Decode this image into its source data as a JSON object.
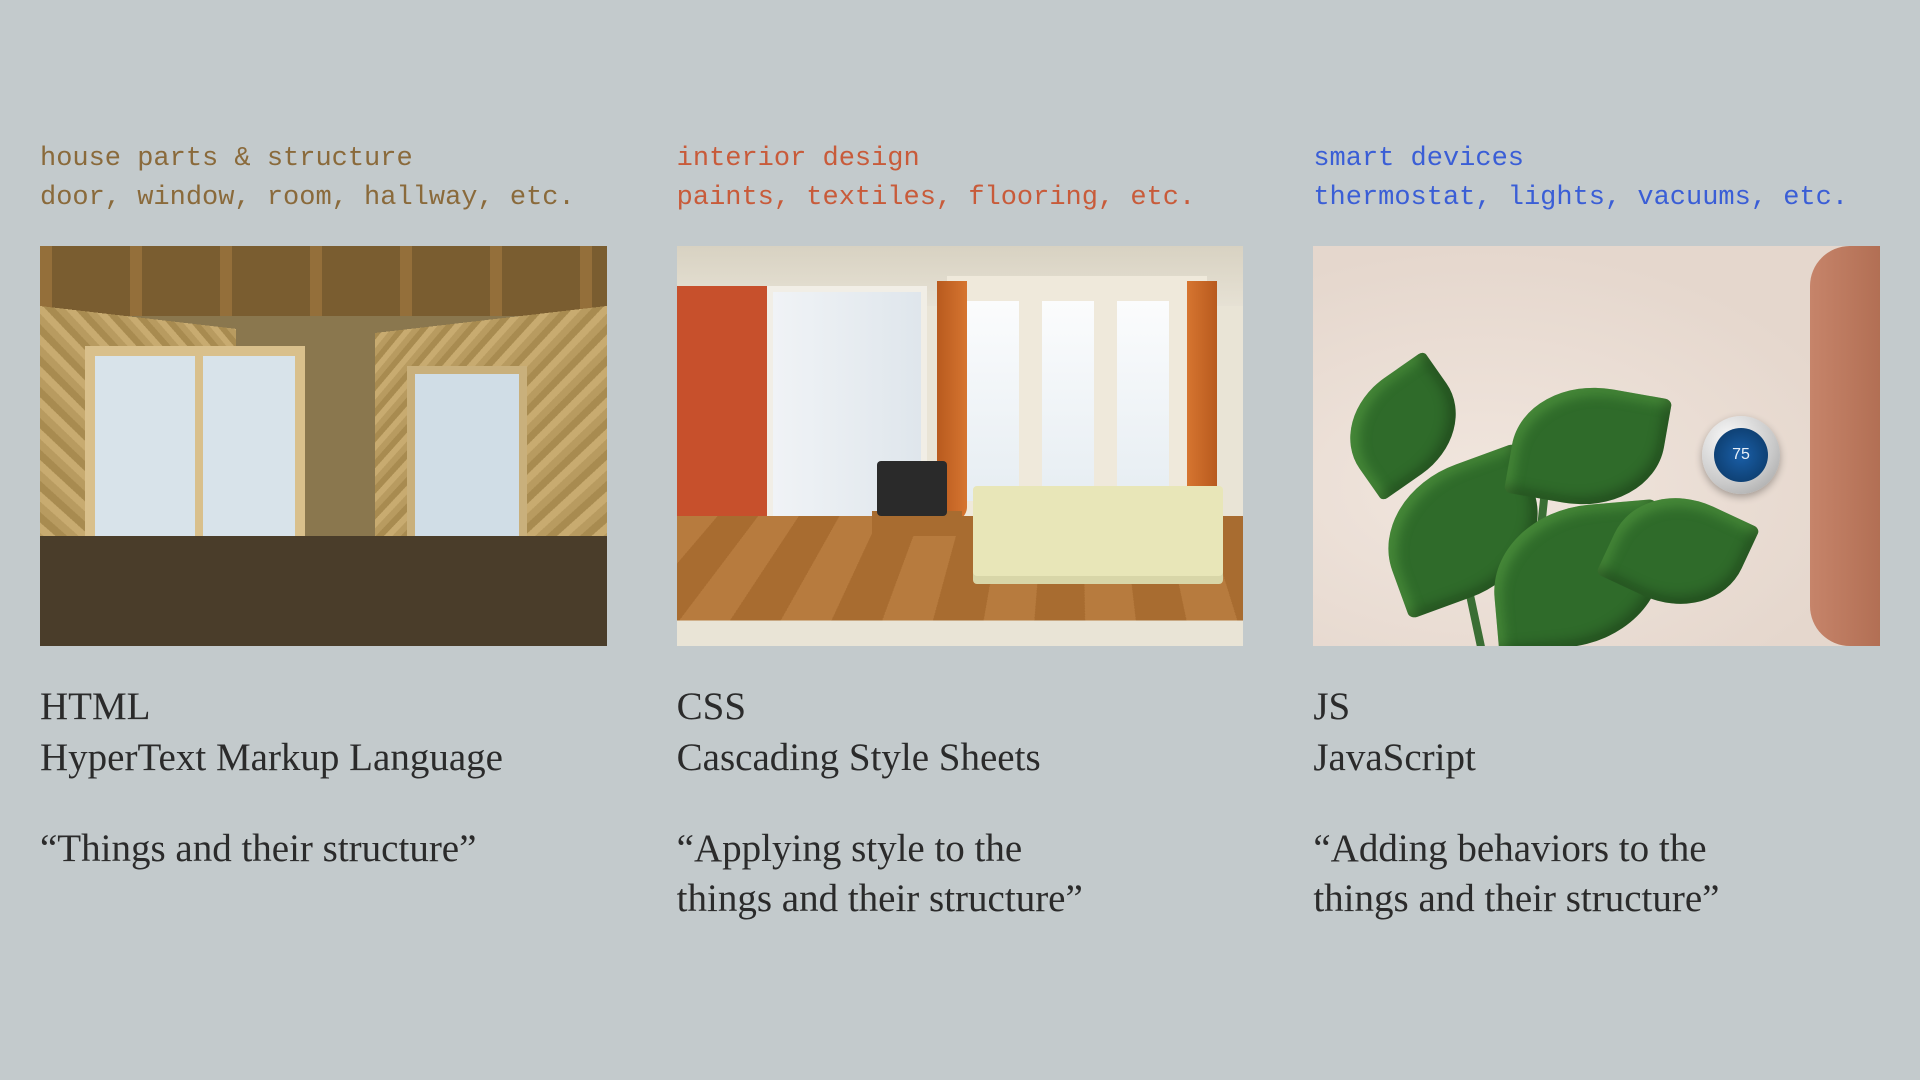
{
  "columns": [
    {
      "mono_label": "house parts & structure\ndoor, window, room, hallway, etc.",
      "image_alt": "Interior of a house under construction showing exposed OSB walls, wooden studs, a sliding glass door and a window",
      "tech_abbrev": "HTML",
      "tech_full": "HyperText Markup Language",
      "tagline": "“Things and their structure”"
    },
    {
      "mono_label": "interior design\npaints, textiles, flooring, etc.",
      "image_alt": "Finished bedroom with wooden flooring, bay windows with orange curtains, a bed, TV and ceiling light",
      "tech_abbrev": "CSS",
      "tech_full": "Cascading Style Sheets",
      "tagline": "“Applying style to the\nthings and their structure”"
    },
    {
      "mono_label": "smart devices\nthermostat, lights, vacuums, etc.",
      "image_alt": "A smart round thermostat mounted on a beige wall next to a large monstera houseplant",
      "thermostat_reading": "75",
      "tech_abbrev": "JS",
      "tech_full": "JavaScript",
      "tagline": "“Adding behaviors to the\nthings and their structure”"
    }
  ],
  "colors": {
    "background": "#c3cacc",
    "html_accent": "#8a6a3b",
    "css_accent": "#c85b3a",
    "js_accent": "#3a5ed6"
  }
}
